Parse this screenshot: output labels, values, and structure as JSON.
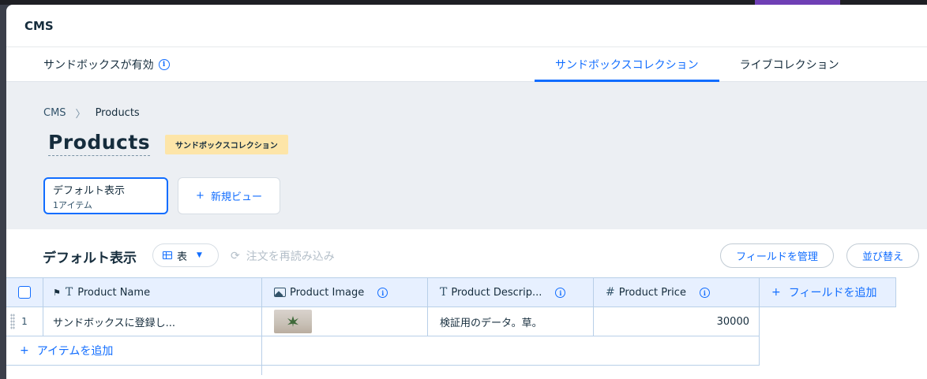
{
  "header": {
    "title": "CMS"
  },
  "sandbox": {
    "status_label": "サンドボックスが有効",
    "tabs": [
      {
        "label": "サンドボックスコレクション",
        "active": true
      },
      {
        "label": "ライブコレクション",
        "active": false
      }
    ]
  },
  "breadcrumb": {
    "root": "CMS",
    "current": "Products"
  },
  "page": {
    "title": "Products",
    "badge": "サンドボックスコレクション"
  },
  "views": {
    "current": {
      "name": "デフォルト表示",
      "count": "1アイテム"
    },
    "new_view_label": "新規ビュー"
  },
  "toolbar": {
    "title": "デフォルト表示",
    "view_type": "表",
    "reload_label": "注文を再読み込み",
    "manage_fields_label": "フィールドを管理",
    "sort_label": "並び替え"
  },
  "table": {
    "columns": [
      {
        "label": "Product Name",
        "icon": "text-icon"
      },
      {
        "label": "Product Image",
        "icon": "image-icon"
      },
      {
        "label": "Product Descrip...",
        "icon": "text-icon"
      },
      {
        "label": "Product Price",
        "icon": "hash-icon"
      }
    ],
    "add_field_label": "フィールドを追加",
    "rows": [
      {
        "index": "1",
        "name": "サンドボックスに登録し...",
        "description": "検証用のデータ。草。",
        "price": "30000"
      }
    ],
    "add_item_label": "アイテムを追加"
  },
  "colors": {
    "accent": "#116dff",
    "badge_bg": "#fde5a8",
    "header_bg": "#e7f0ff",
    "area_bg": "#eceff3"
  }
}
